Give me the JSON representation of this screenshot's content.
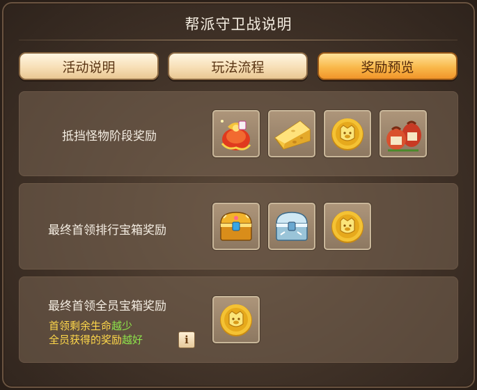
{
  "window": {
    "title": "帮派守卫战说明"
  },
  "tabs": [
    {
      "label": "活动说明",
      "active": false
    },
    {
      "label": "玩法流程",
      "active": false
    },
    {
      "label": "奖励预览",
      "active": true
    }
  ],
  "sections": [
    {
      "label": "抵挡怪物阶段奖励",
      "items": [
        "lucky-bag-icon",
        "cheese-icon",
        "gold-coin-icon",
        "gift-sacks-icon"
      ]
    },
    {
      "label": "最终首领排行宝箱奖励",
      "items": [
        "gold-chest-icon",
        "silver-chest-icon",
        "gold-coin-icon"
      ]
    },
    {
      "label": "最终首领全员宝箱奖励",
      "items": [
        "gold-coin-icon"
      ],
      "note": {
        "line1_prefix": "首领剩余生命",
        "line1_highlight": "越少",
        "line2_prefix": "全员获得的奖励",
        "line2_highlight": "越好"
      },
      "info_label": "i"
    }
  ],
  "colors": {
    "accent_tab": "#f9b84a",
    "note_text": "#ffd84a",
    "note_highlight": "#8ee34a"
  }
}
